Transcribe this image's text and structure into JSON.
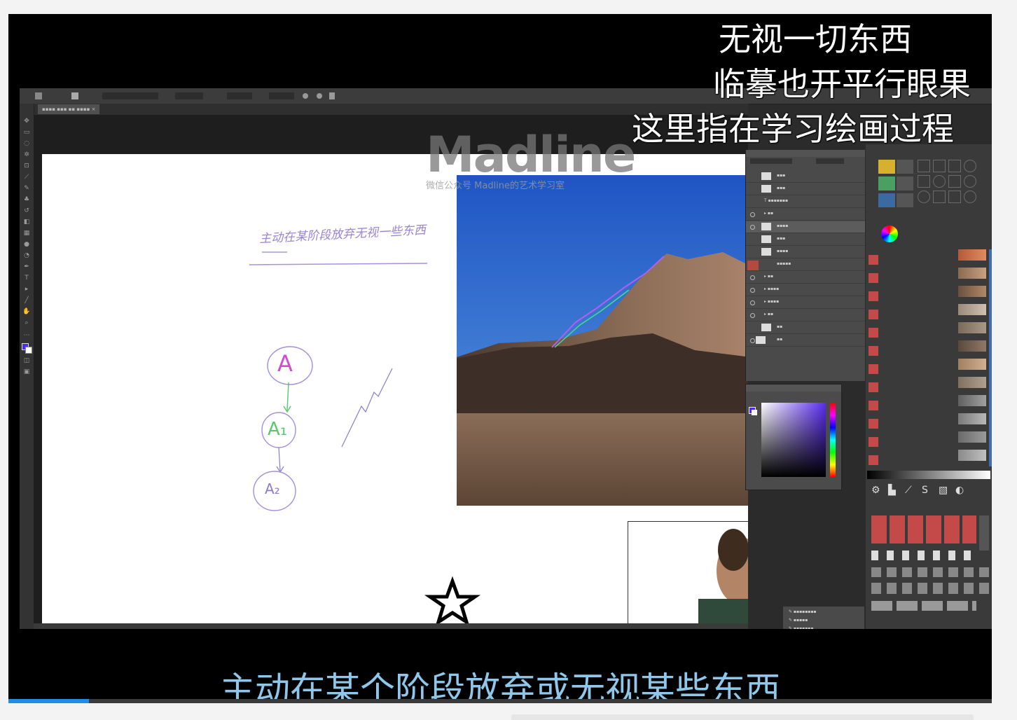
{
  "subtitles": {
    "top_line1": "无视一切东西",
    "top_line2": "临摹也开平行眼果",
    "top_line3": "这里指在学习绘画过程",
    "bottom": "主动在某个阶段放弃或无视某些东西"
  },
  "watermark": {
    "logo": "Madline",
    "sub": "微信公众号    Madline的艺术学习室"
  },
  "canvas_notes": {
    "heading": "主动在某阶段放弃无视一些东西",
    "node_a": "A",
    "node_a1": "A₁",
    "node_a2": "A₂"
  },
  "player": {
    "progress": 0.082
  },
  "colors": {
    "subtitle_bottom": "#8fc7ea",
    "progress": "#1f8ce6",
    "ps_panel": "#4a4a4a",
    "ext_red": "#c44a4a"
  }
}
